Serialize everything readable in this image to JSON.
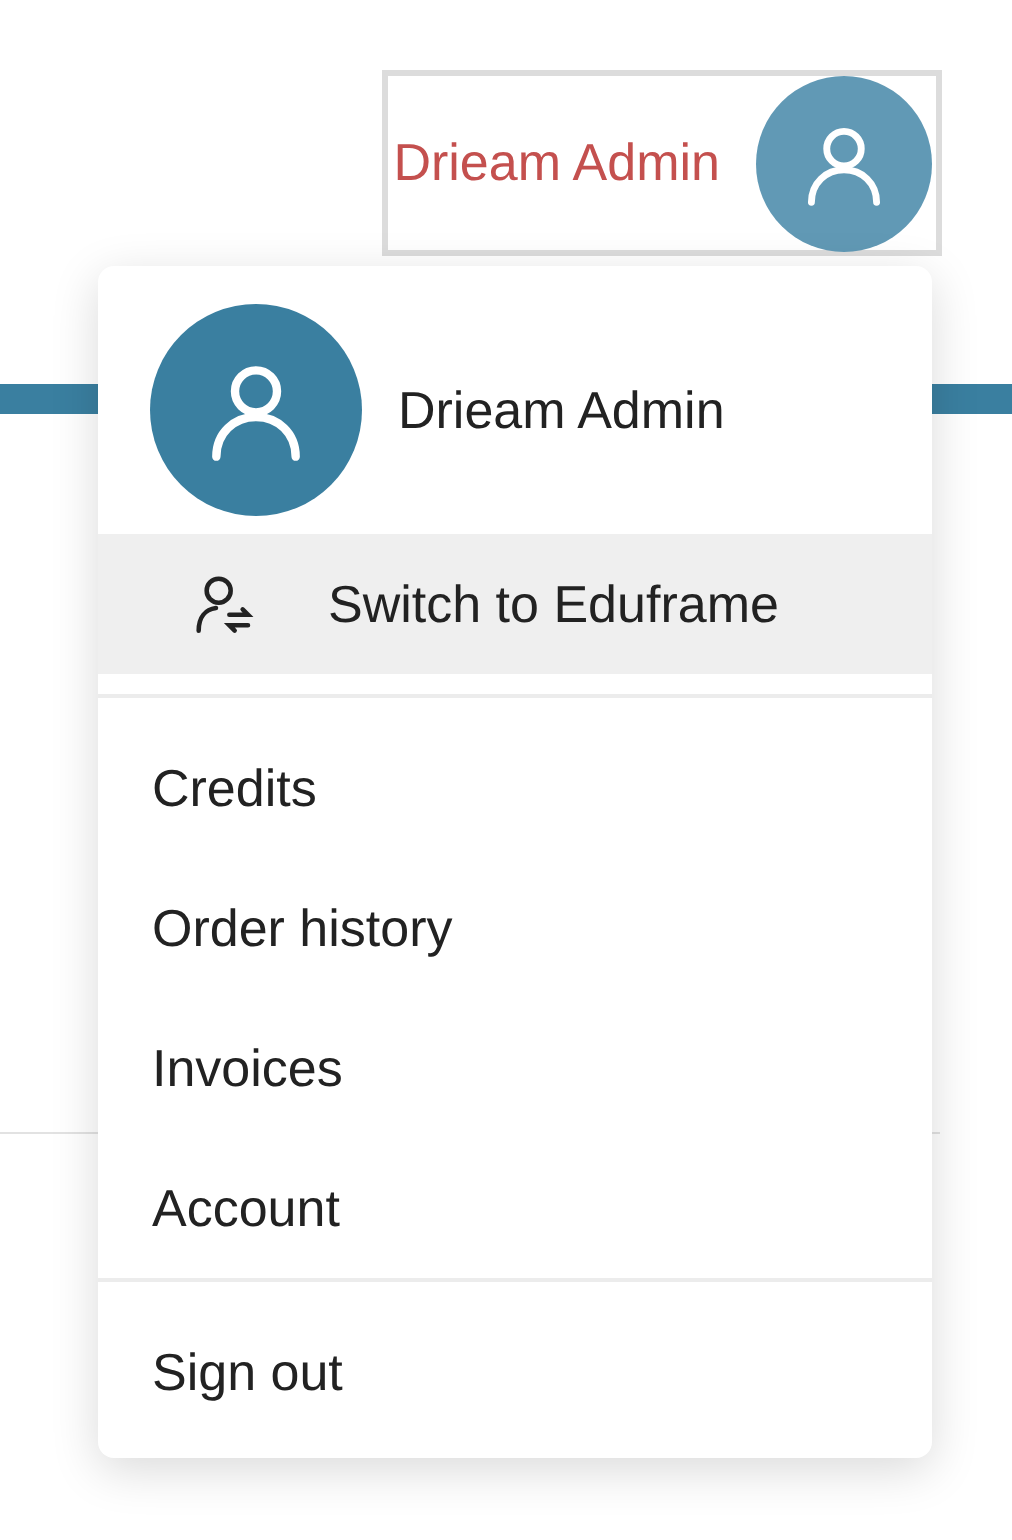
{
  "account_button": {
    "name": "Drieam Admin"
  },
  "menu": {
    "header": {
      "name": "Drieam Admin"
    },
    "sections": [
      {
        "items": [
          {
            "kind": "switch",
            "label": "Switch to Eduframe",
            "highlighted": true
          }
        ]
      },
      {
        "items": [
          {
            "kind": "link",
            "label": "Credits",
            "highlighted": false
          },
          {
            "kind": "link",
            "label": "Order history",
            "highlighted": false
          },
          {
            "kind": "link",
            "label": "Invoices",
            "highlighted": false
          },
          {
            "kind": "link",
            "label": "Account",
            "highlighted": false
          }
        ]
      },
      {
        "items": [
          {
            "kind": "link",
            "label": "Sign out",
            "highlighted": false
          }
        ]
      }
    ]
  }
}
